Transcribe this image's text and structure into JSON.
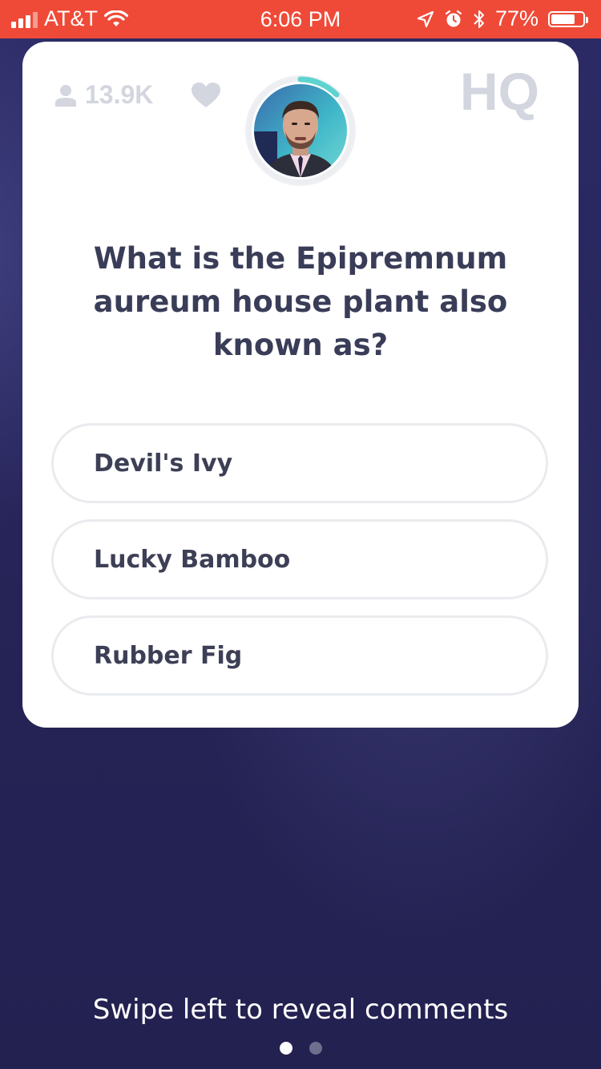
{
  "status_bar": {
    "carrier": "AT&T",
    "time": "6:06 PM",
    "battery": "77%",
    "battery_level": 0.77,
    "color": "#ef4a38"
  },
  "header": {
    "viewer_count": "13.9K",
    "user_icon": "user-icon",
    "heart_icon": "heart-icon",
    "logo": "HQ"
  },
  "question": {
    "text": "What is the Epipremnum aureum house plant also known as?"
  },
  "answers": [
    {
      "label": "Devil's Ivy"
    },
    {
      "label": "Lucky Bamboo"
    },
    {
      "label": "Rubber Fig"
    }
  ],
  "footer": {
    "hint": "Swipe left to reveal comments",
    "pages": 2,
    "active_page": 0
  },
  "colors": {
    "background": "#262458",
    "card": "#ffffff",
    "question_text": "#3a3d58",
    "timer_ring": "#5fd3cf",
    "muted_icon": "#d3d5df"
  }
}
